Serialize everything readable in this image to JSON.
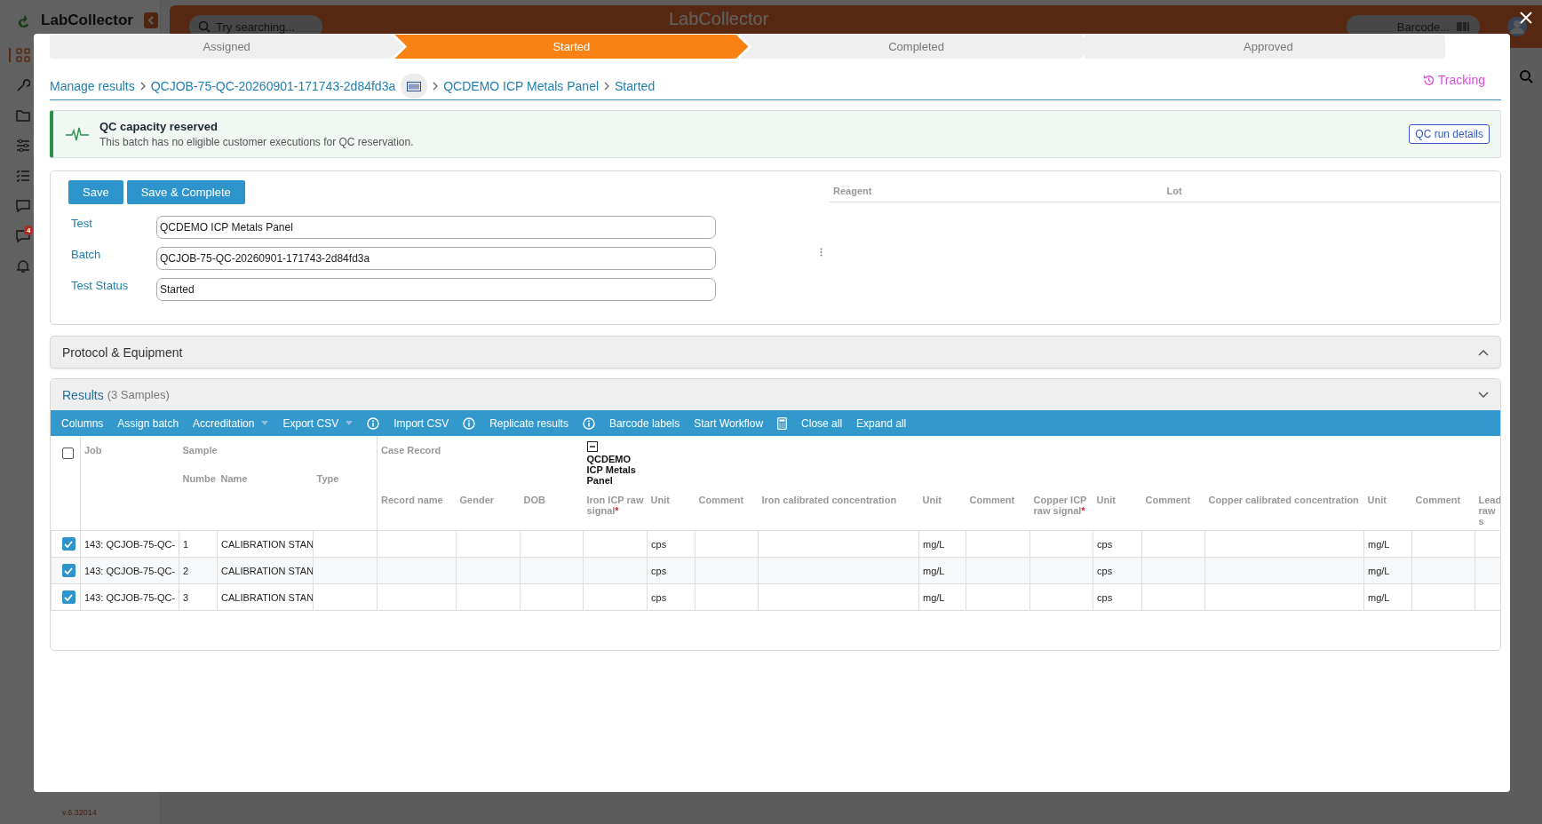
{
  "app": {
    "logo": "LabCollector",
    "search_placeholder": "Try searching...",
    "header_logo": "LabCollector",
    "barcode_placeholder": "Barcode...",
    "version": "v.6.32014",
    "badge": "4"
  },
  "modal": {
    "steps": [
      {
        "label": "Assigned",
        "selected": false
      },
      {
        "label": "Started",
        "selected": true
      },
      {
        "label": "Completed",
        "selected": false
      },
      {
        "label": "Approved",
        "selected": false
      }
    ],
    "breadcrumb": [
      {
        "kind": "link",
        "label": "Manage results"
      },
      {
        "kind": "link",
        "label": "QCJOB-75-QC-20260901-171743-2d84fd3a"
      },
      {
        "kind": "barcode"
      },
      {
        "kind": "link",
        "label": "QCDEMO ICP Metals Panel"
      },
      {
        "kind": "link",
        "label": "Started"
      }
    ],
    "tracking": "Tracking",
    "alert": {
      "title": "QC capacity reserved",
      "message": "This batch has no eligible customer executions for QC reservation.",
      "button": "QC run details"
    },
    "form": {
      "buttons": [
        "Save",
        "Save & Complete"
      ],
      "fields": [
        {
          "label": "Test",
          "value": "QCDEMO ICP Metals Panel"
        },
        {
          "label": "Batch",
          "value": "QCJOB-75-QC-20260901-171743-2d84fd3a"
        },
        {
          "label": "Test Status",
          "value": "Started"
        }
      ],
      "reagent_columns": [
        "Reagent",
        "Lot"
      ]
    },
    "protocol": {
      "title": "Protocol & Equipment",
      "collapsed": true
    },
    "results": {
      "title": "Results",
      "count": "(3 Samples)",
      "collapsed": false,
      "toolbar": [
        {
          "kind": "button",
          "label": "Columns"
        },
        {
          "kind": "button",
          "label": "Assign batch"
        },
        {
          "kind": "dropdown",
          "label": "Accreditation"
        },
        {
          "kind": "dropdown",
          "label": "Export CSV"
        },
        {
          "kind": "info"
        },
        {
          "kind": "button",
          "label": "Import CSV"
        },
        {
          "kind": "info"
        },
        {
          "kind": "button",
          "label": "Replicate results"
        },
        {
          "kind": "info"
        },
        {
          "kind": "button",
          "label": "Barcode labels"
        },
        {
          "kind": "button",
          "label": "Start Workflow"
        },
        {
          "kind": "calculator"
        },
        {
          "kind": "button",
          "label": "Close all"
        },
        {
          "kind": "button",
          "label": "Expand all"
        }
      ],
      "table": {
        "select_all": false,
        "required_mark": "*",
        "job": "Job",
        "sample": "Sample",
        "case_record": "Case Record",
        "panel": "QCDEMO ICP Metals Panel",
        "sample_columns": [
          "Numbe",
          "Name",
          "Type"
        ],
        "columns": [
          {
            "label": "Record name",
            "required": false
          },
          {
            "label": "Gender",
            "required": false
          },
          {
            "label": "DOB",
            "required": false
          },
          {
            "label": "Iron ICP raw signal",
            "required": true
          },
          {
            "label": "Unit",
            "required": false
          },
          {
            "label": "Comment",
            "required": false
          },
          {
            "label": "Iron calibrated concentration",
            "required": false
          },
          {
            "label": "Unit",
            "required": false
          },
          {
            "label": "Comment",
            "required": false
          },
          {
            "label": "Copper ICP raw signal",
            "required": true
          },
          {
            "label": "Unit",
            "required": false
          },
          {
            "label": "Comment",
            "required": false
          },
          {
            "label": "Copper calibrated concentration",
            "required": false
          },
          {
            "label": "Unit",
            "required": false
          },
          {
            "label": "Comment",
            "required": false
          },
          {
            "label": "Lead raw s",
            "required": false
          }
        ],
        "rows": [
          {
            "selected": true,
            "job": "143: QCJOB-75-QC-",
            "number": "1",
            "name": "CALIBRATION STAN",
            "values": {
              "4": "cps",
              "7": "mg/L",
              "10": "cps",
              "13": "mg/L"
            }
          },
          {
            "selected": true,
            "job": "143: QCJOB-75-QC-",
            "number": "2",
            "name": "CALIBRATION STAN",
            "values": {
              "4": "cps",
              "7": "mg/L",
              "10": "cps",
              "13": "mg/L"
            }
          },
          {
            "selected": true,
            "job": "143: QCJOB-75-QC-",
            "number": "3",
            "name": "CALIBRATION STAN",
            "values": {
              "4": "cps",
              "7": "mg/L",
              "10": "cps",
              "13": "mg/L"
            }
          }
        ]
      }
    }
  }
}
